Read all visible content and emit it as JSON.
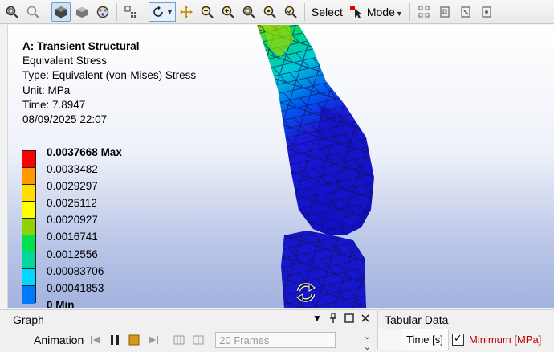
{
  "toolbar": {
    "select_label": "Select",
    "mode_label": "Mode",
    "icons": [
      "zoom-to-fit-icon",
      "zoom-icon",
      "solid-view-icon",
      "shaded-view-icon",
      "wireframe-icon",
      "select-box-icon",
      "rotate-icon",
      "pan-icon",
      "zoom-in-icon",
      "zoom-box-icon",
      "zoom-out-icon",
      "zoom-fit-icon",
      "zoom-previous-icon",
      "select-cursor-icon",
      "select-filter-icon",
      "select-face-icon",
      "select-edge-icon",
      "select-vertex-icon"
    ]
  },
  "viewport": {
    "analysis_title": "A: Transient Structural",
    "result_name": "Equivalent Stress",
    "result_type": "Type: Equivalent (von-Mises) Stress",
    "unit": "Unit: MPa",
    "time": "Time: 7.8947",
    "date": "08/09/2025 22:07"
  },
  "legend": {
    "labels": [
      "0.0037668 Max",
      "0.0033482",
      "0.0029297",
      "0.0025112",
      "0.0020927",
      "0.0016741",
      "0.0012556",
      "0.00083706",
      "0.00041853",
      "0 Min"
    ],
    "colors": [
      "#ff0000",
      "#ff9900",
      "#ffdd00",
      "#ffff00",
      "#8fd400",
      "#00e050",
      "#00d8a0",
      "#00d8ff",
      "#0078ff",
      "#0000cc"
    ]
  },
  "graph_panel": {
    "title": "Graph",
    "animation_label": "Animation",
    "frames_value": "20 Frames"
  },
  "tabular_panel": {
    "title": "Tabular Data",
    "col_time": "Time [s]",
    "col_min": "Minimum [MPa]"
  }
}
